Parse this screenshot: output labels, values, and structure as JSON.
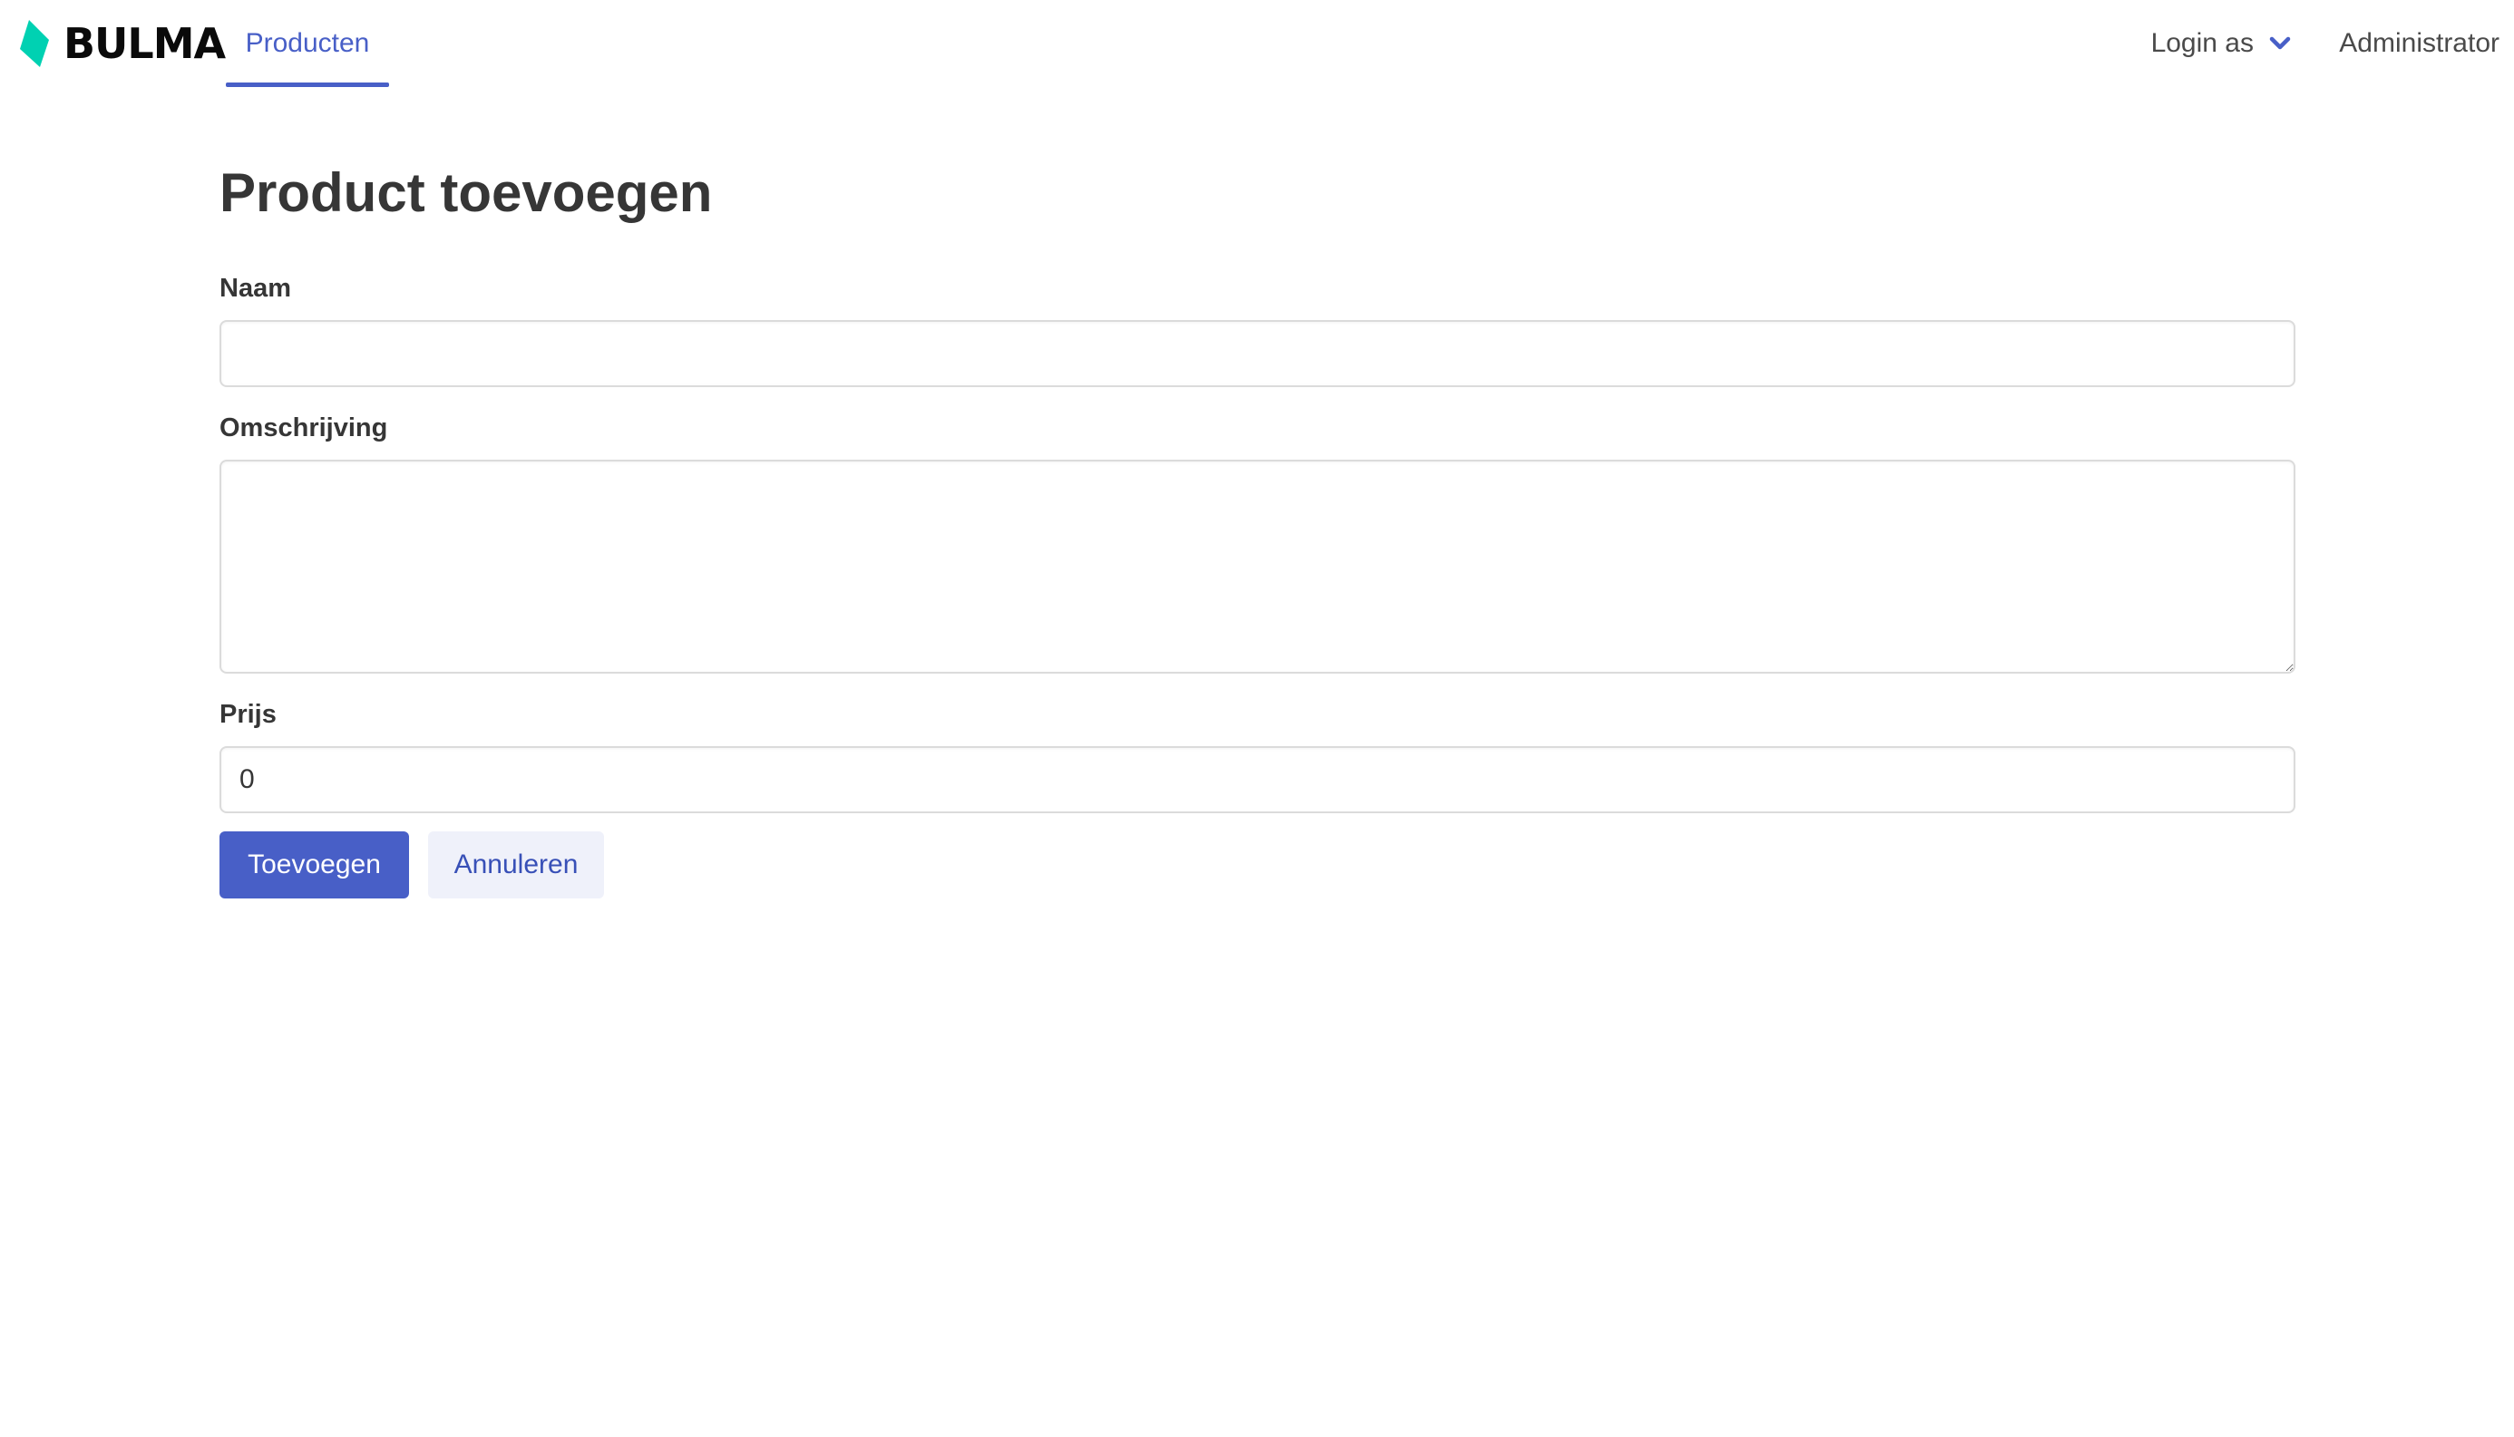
{
  "navbar": {
    "brand": "BULMA",
    "brand_mark_color": "#00d1b2",
    "products_label": "Producten",
    "login_as_label": "Login as",
    "login_as_icon": "chevron-down-icon",
    "admin_label": "Administrator",
    "accent_color": "#485fc7"
  },
  "main": {
    "title": "Product toevoegen",
    "fields": {
      "name_label": "Naam",
      "name_value": "",
      "description_label": "Omschrijving",
      "description_value": "",
      "price_label": "Prijs",
      "price_value": "0"
    },
    "buttons": {
      "submit_label": "Toevoegen",
      "cancel_label": "Annuleren"
    }
  }
}
